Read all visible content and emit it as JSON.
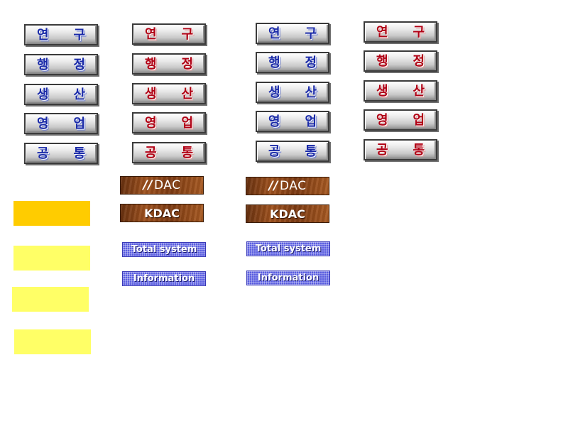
{
  "columns": [
    {
      "style": "blue",
      "buttons": [
        {
          "c1": "연",
          "c2": "구"
        },
        {
          "c1": "행",
          "c2": "정"
        },
        {
          "c1": "생",
          "c2": "산"
        },
        {
          "c1": "영",
          "c2": "업"
        },
        {
          "c1": "공",
          "c2": "통"
        }
      ]
    },
    {
      "style": "red",
      "buttons": [
        {
          "c1": "연",
          "c2": "구"
        },
        {
          "c1": "행",
          "c2": "정"
        },
        {
          "c1": "생",
          "c2": "산"
        },
        {
          "c1": "영",
          "c2": "업"
        },
        {
          "c1": "공",
          "c2": "통"
        }
      ]
    },
    {
      "style": "blue",
      "buttons": [
        {
          "c1": "연",
          "c2": "구"
        },
        {
          "c1": "행",
          "c2": "정"
        },
        {
          "c1": "생",
          "c2": "산"
        },
        {
          "c1": "영",
          "c2": "업"
        },
        {
          "c1": "공",
          "c2": "통"
        }
      ]
    },
    {
      "style": "red",
      "buttons": [
        {
          "c1": "연",
          "c2": "구"
        },
        {
          "c1": "행",
          "c2": "정"
        },
        {
          "c1": "생",
          "c2": "산"
        },
        {
          "c1": "영",
          "c2": "업"
        },
        {
          "c1": "공",
          "c2": "통"
        }
      ]
    }
  ],
  "wood_buttons": {
    "logo_mark": "//",
    "logo_text": "DAC",
    "text_label": "KDAC"
  },
  "grid_buttons": {
    "total_label": "Total system",
    "info_label": "Information"
  },
  "colors": {
    "swatch_orange": "#ffcc00",
    "swatch_yellow": "#ffff66"
  }
}
